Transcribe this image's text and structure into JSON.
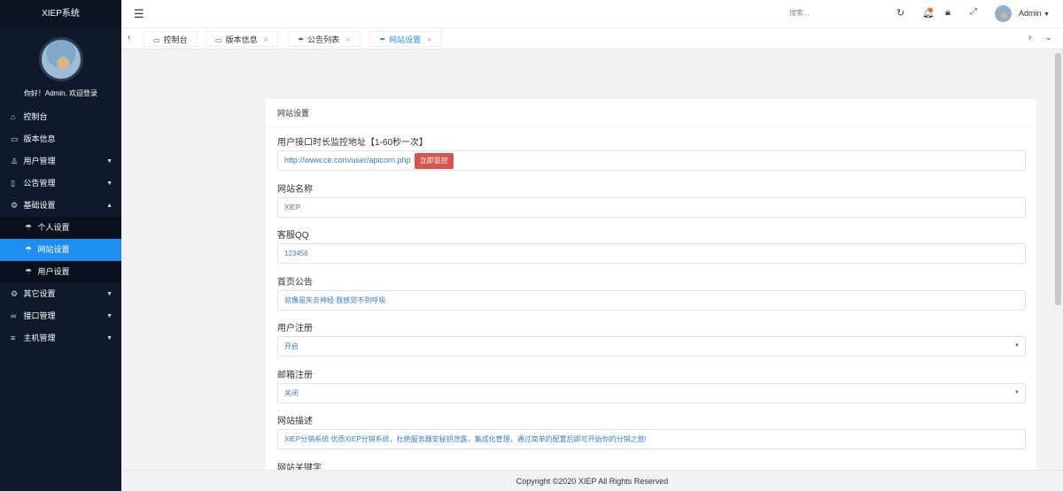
{
  "sidebar": {
    "title": "XIEP系统",
    "greeting": "你好！Admin, 欢迎登录",
    "items": [
      {
        "label": "控制台",
        "icon": "home-icon",
        "glyph": "⌂"
      },
      {
        "label": "版本信息",
        "icon": "monitor-icon",
        "glyph": "▭"
      },
      {
        "label": "用户管理",
        "icon": "user-icon",
        "glyph": "♙"
      },
      {
        "label": "公告管理",
        "icon": "book-icon",
        "glyph": "▯"
      },
      {
        "label": "基础设置",
        "icon": "gear-icon",
        "glyph": "⚙"
      },
      {
        "label": "个人设置",
        "icon": "umbrella-icon",
        "glyph": "☂"
      },
      {
        "label": "网站设置",
        "icon": "umbrella-icon",
        "glyph": "☂"
      },
      {
        "label": "用户设置",
        "icon": "umbrella-icon",
        "glyph": "☂"
      },
      {
        "label": "其它设置",
        "icon": "gear-icon",
        "glyph": "⚙"
      },
      {
        "label": "接口管理",
        "icon": "link-icon",
        "glyph": "∞"
      },
      {
        "label": "主机管理",
        "icon": "list-icon",
        "glyph": "≡"
      }
    ]
  },
  "topbar": {
    "search_placeholder": "搜索...",
    "username": "Admin"
  },
  "tabs": [
    {
      "label": "控制台",
      "closable": false
    },
    {
      "label": "版本信息",
      "closable": true
    },
    {
      "label": "公告列表",
      "closable": true
    },
    {
      "label": "网站设置",
      "closable": true
    }
  ],
  "form": {
    "card_title": "网站设置",
    "monitor_label": "用户接口时长监控地址【1-60秒一次】",
    "monitor_url": "http://www.ce.com/user/apicorn.php",
    "monitor_button": "立即监控",
    "site_name_label": "网站名称",
    "site_name_value": "XIEP",
    "qq_label": "客服QQ",
    "qq_value": "123456",
    "notice_label": "首页公告",
    "notice_value": "就像是失去神经 我感觉不到呼吸",
    "register_label": "用户注册",
    "register_value": "开启",
    "email_label": "邮箱注册",
    "email_value": "关闭",
    "desc_label": "网站描述",
    "desc_value": "XIEP分销系统 优质XIEP分销系统，杜绝服务器安秘钥泄露，集成化管理，通过简单的配置后即可开始你的分销之旅!",
    "keywords_label": "网站关键字"
  },
  "footer": {
    "copyright": "Copyright ©2020 XIEP All Rights Reserved"
  },
  "colors": {
    "sidebar_bg": "#0e1a2b",
    "active": "#1e8ff0",
    "button_red": "#d9534f",
    "badge": "#ff5722"
  }
}
